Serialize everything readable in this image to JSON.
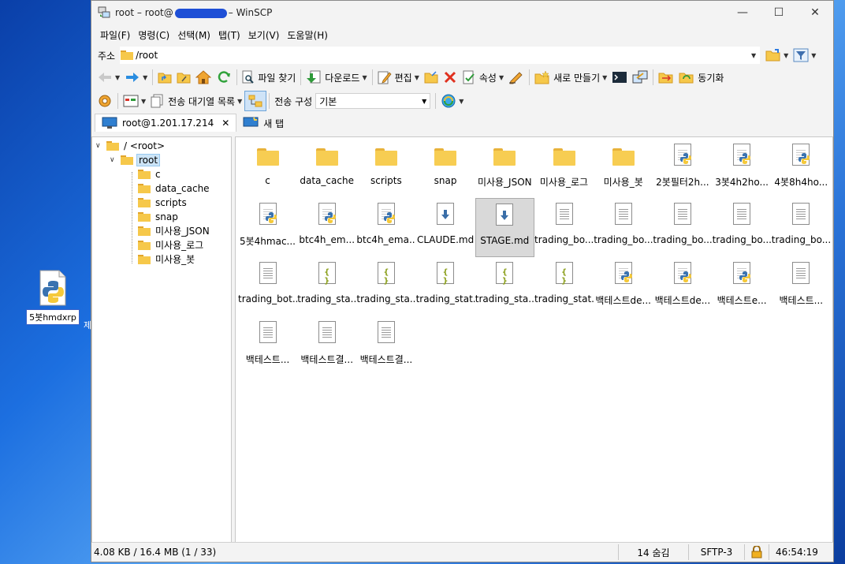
{
  "desktop": {
    "icon_label": "5봇hmdxrp",
    "partial_text": "제"
  },
  "window": {
    "title_prefix": "root – root@",
    "title_suffix": "– WinSCP"
  },
  "menu": [
    "파일(F)",
    "명령(C)",
    "선택(M)",
    "탭(T)",
    "보기(V)",
    "도움말(H)"
  ],
  "address": {
    "label": "주소",
    "path": "/root"
  },
  "toolbar1": {
    "find": "파일 찾기",
    "download": "다운로드",
    "edit": "편집",
    "properties": "속성",
    "new": "새로 만들기",
    "sync": "동기화"
  },
  "toolbar2": {
    "queue": "전송 대기열 목록",
    "transfer_settings_label": "전송 구성",
    "transfer_settings_value": "기본"
  },
  "tabs": {
    "session": "root@1.201.17.214",
    "new_tab": "새 탭"
  },
  "tree": [
    {
      "label": "/ <root>",
      "level": 0,
      "expanded": true
    },
    {
      "label": "root",
      "level": 1,
      "expanded": true,
      "selected": true
    },
    {
      "label": "c",
      "level": 2
    },
    {
      "label": "data_cache",
      "level": 2
    },
    {
      "label": "scripts",
      "level": 2
    },
    {
      "label": "snap",
      "level": 2
    },
    {
      "label": "미사용_JSON",
      "level": 2
    },
    {
      "label": "미사용_로그",
      "level": 2
    },
    {
      "label": "미사용_봇",
      "level": 2
    }
  ],
  "files": [
    {
      "name": "c",
      "type": "folder"
    },
    {
      "name": "data_cache",
      "type": "folder"
    },
    {
      "name": "scripts",
      "type": "folder"
    },
    {
      "name": "snap",
      "type": "folder"
    },
    {
      "name": "미사용_JSON",
      "type": "folder"
    },
    {
      "name": "미사용_로그",
      "type": "folder"
    },
    {
      "name": "미사용_봇",
      "type": "folder"
    },
    {
      "name": "2봇필터2h...",
      "type": "python"
    },
    {
      "name": "3봇4h2ho...",
      "type": "python"
    },
    {
      "name": "4봇8h4ho...",
      "type": "python"
    },
    {
      "name": "5봇4hmac...",
      "type": "python"
    },
    {
      "name": "btc4h_em...",
      "type": "python"
    },
    {
      "name": "btc4h_ema...",
      "type": "python"
    },
    {
      "name": "CLAUDE.md",
      "type": "markdown"
    },
    {
      "name": "STAGE.md",
      "type": "markdown",
      "selected": true
    },
    {
      "name": "trading_bo...",
      "type": "text"
    },
    {
      "name": "trading_bo...",
      "type": "text"
    },
    {
      "name": "trading_bo...",
      "type": "text"
    },
    {
      "name": "trading_bo...",
      "type": "text"
    },
    {
      "name": "trading_bo...",
      "type": "text"
    },
    {
      "name": "trading_bot...",
      "type": "text"
    },
    {
      "name": "trading_sta...",
      "type": "json"
    },
    {
      "name": "trading_sta...",
      "type": "json"
    },
    {
      "name": "trading_stat...",
      "type": "json"
    },
    {
      "name": "trading_sta...",
      "type": "json"
    },
    {
      "name": "trading_stat...",
      "type": "json"
    },
    {
      "name": "백테스트de...",
      "type": "python"
    },
    {
      "name": "백테스트de...",
      "type": "python"
    },
    {
      "name": "백테스트e...",
      "type": "python"
    },
    {
      "name": "백테스트...",
      "type": "text"
    },
    {
      "name": "백테스트...",
      "type": "text"
    },
    {
      "name": "백테스트결...",
      "type": "text"
    },
    {
      "name": "백테스트결...",
      "type": "text"
    }
  ],
  "status": {
    "selection": "4.08 KB / 16.4 MB (1 / 33)",
    "hidden": "14 숨김",
    "protocol": "SFTP-3",
    "time": "46:54:19"
  }
}
